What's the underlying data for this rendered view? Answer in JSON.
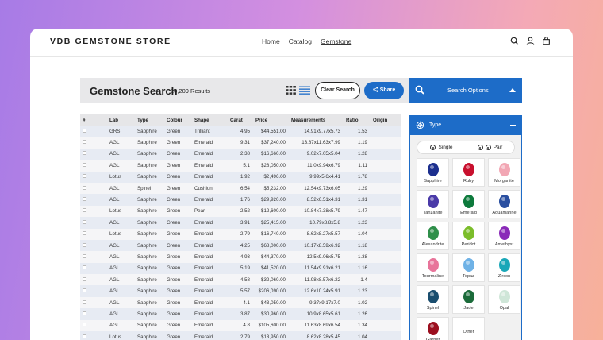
{
  "store": {
    "brand": "VDB GEMSTONE STORE",
    "nav": [
      "Home",
      "Catalog",
      "Gemstone"
    ],
    "icons": [
      "search-icon",
      "user-icon",
      "cart-icon"
    ]
  },
  "search": {
    "title": "Gemstone Search",
    "results": "10,209 Results",
    "clear": "Clear Search",
    "share": "Share"
  },
  "table": {
    "headers": [
      "#",
      "Lab",
      "Type",
      "Colour",
      "Shape",
      "Carat",
      "Price",
      "Measurements",
      "Ratio",
      "Origin"
    ],
    "rows": [
      [
        "GRS",
        "Sapphire",
        "Green",
        "Trilliant",
        "4.95",
        "$44,551.00",
        "14.91x9.77x5.73",
        "1.53",
        ""
      ],
      [
        "AGL",
        "Sapphire",
        "Green",
        "Emerald",
        "9.31",
        "$37,240.00",
        "13.87x11.63x7.99",
        "1.19",
        ""
      ],
      [
        "AGL",
        "Sapphire",
        "Green",
        "Emerald",
        "2.38",
        "$16,660.00",
        "9.02x7.05x5.04",
        "1.28",
        ""
      ],
      [
        "AGL",
        "Sapphire",
        "Green",
        "Emerald",
        "5.1",
        "$28,050.00",
        "11.0x9.94x6.79",
        "1.11",
        ""
      ],
      [
        "Lotus",
        "Sapphire",
        "Green",
        "Emerald",
        "1.92",
        "$2,496.00",
        "9.99x5.6x4.41",
        "1.78",
        ""
      ],
      [
        "AGL",
        "Spinel",
        "Green",
        "Cushion",
        "6.54",
        "$5,232.00",
        "12.54x9.73x6.05",
        "1.29",
        ""
      ],
      [
        "AGL",
        "Sapphire",
        "Green",
        "Emerald",
        "1.76",
        "$29,920.00",
        "8.52x6.51x4.31",
        "1.31",
        ""
      ],
      [
        "Lotus",
        "Sapphire",
        "Green",
        "Pear",
        "2.52",
        "$12,600.00",
        "10.84x7.38x5.79",
        "1.47",
        ""
      ],
      [
        "AGL",
        "Sapphire",
        "Green",
        "Emerald",
        "3.91",
        "$25,415.00",
        "10.79x8.8x5.8",
        "1.23",
        ""
      ],
      [
        "Lotus",
        "Sapphire",
        "Green",
        "Emerald",
        "2.79",
        "$16,740.00",
        "8.62x8.27x5.57",
        "1.04",
        ""
      ],
      [
        "AGL",
        "Sapphire",
        "Green",
        "Emerald",
        "4.25",
        "$68,000.00",
        "10.17x8.59x6.92",
        "1.18",
        ""
      ],
      [
        "AGL",
        "Sapphire",
        "Green",
        "Emerald",
        "4.93",
        "$44,370.00",
        "12.5x9.06x5.75",
        "1.38",
        ""
      ],
      [
        "AGL",
        "Sapphire",
        "Green",
        "Emerald",
        "5.19",
        "$41,520.00",
        "11.54x9.91x6.21",
        "1.16",
        ""
      ],
      [
        "AGL",
        "Sapphire",
        "Green",
        "Emerald",
        "4.58",
        "$32,060.00",
        "11.98x8.57x6.22",
        "1.4",
        ""
      ],
      [
        "AGL",
        "Sapphire",
        "Green",
        "Emerald",
        "5.57",
        "$206,090.00",
        "12.6x10.24x5.91",
        "1.23",
        ""
      ],
      [
        "AGL",
        "Sapphire",
        "Green",
        "Emerald",
        "4.1",
        "$43,050.00",
        "9.37x9.17x7.0",
        "1.02",
        ""
      ],
      [
        "AGL",
        "Sapphire",
        "Green",
        "Emerald",
        "3.87",
        "$30,960.00",
        "10.9x8.65x5.61",
        "1.26",
        ""
      ],
      [
        "AGL",
        "Sapphire",
        "Green",
        "Emerald",
        "4.8",
        "$105,600.00",
        "11.63x8.69x6.54",
        "1.34",
        ""
      ],
      [
        "Lotus",
        "Sapphire",
        "Green",
        "Emerald",
        "2.79",
        "$13,950.00",
        "8.62x8.28x5.45",
        "1.04",
        ""
      ]
    ]
  },
  "sidebar": {
    "search_options": "Search Options",
    "type_label": "Type",
    "single": "Single",
    "pair": "Pair",
    "gems": [
      {
        "name": "Sapphire",
        "color": "#1c2f8e"
      },
      {
        "name": "Ruby",
        "color": "#c8102e"
      },
      {
        "name": "Morganite",
        "color": "#f2a7b4"
      },
      {
        "name": "Tanzanite",
        "color": "#4a3aa8"
      },
      {
        "name": "Emerald",
        "color": "#0d7a3c"
      },
      {
        "name": "Aquamarine",
        "color": "#2a4fa0"
      },
      {
        "name": "Alexandrite",
        "color": "#2f8f4a"
      },
      {
        "name": "Peridot",
        "color": "#7bbd2a"
      },
      {
        "name": "Amethyst",
        "color": "#8a2ab8"
      },
      {
        "name": "Tourmaline",
        "color": "#e8749a"
      },
      {
        "name": "Topaz",
        "color": "#6fb2e6"
      },
      {
        "name": "Zircon",
        "color": "#19a7b8"
      },
      {
        "name": "Spinel",
        "color": "#1a4d6e"
      },
      {
        "name": "Jade",
        "color": "#1b6b3a"
      },
      {
        "name": "Opal",
        "color": "#cfe6d8"
      },
      {
        "name": "Garnet",
        "color": "#9b0f1f"
      },
      {
        "name": "Other",
        "color": ""
      }
    ]
  }
}
